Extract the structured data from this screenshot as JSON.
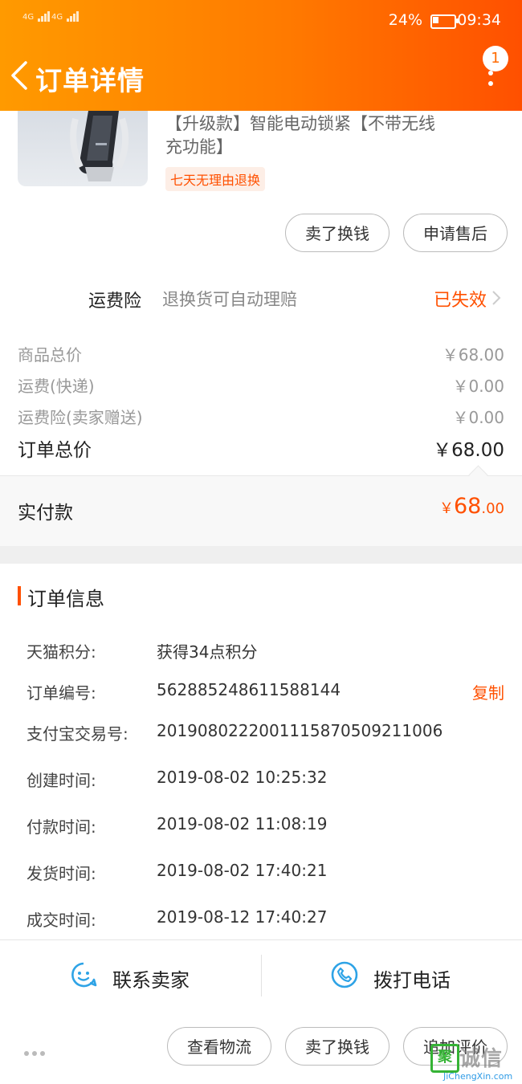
{
  "status_bar": {
    "signal_1": "4G",
    "signal_2": "4G",
    "battery_percent": "24%",
    "time": "09:34"
  },
  "header": {
    "title": "订单详情",
    "notification_count": "1"
  },
  "product": {
    "title": "【升级款】智能电动锁紧【不带无线充功能】",
    "return_tag": "七天无理由退换",
    "actions": [
      "卖了换钱",
      "申请售后"
    ]
  },
  "insurance": {
    "label": "运费险",
    "description": "退换货可自动理赔",
    "status": "已失效"
  },
  "prices": [
    {
      "label": "商品总价",
      "value": "￥68.00"
    },
    {
      "label": "运费(快递)",
      "value": "￥0.00"
    },
    {
      "label": "运费险(卖家赠送)",
      "value": "￥0.00"
    }
  ],
  "order_total": {
    "label": "订单总价",
    "value": "￥68.00"
  },
  "paid": {
    "label": "实付款",
    "currency": "￥",
    "main": "68",
    "decimal": ".00"
  },
  "order_info": {
    "title": "订单信息",
    "copy_label": "复制",
    "rows": [
      {
        "key": "天猫积分:",
        "value": "获得34点积分"
      },
      {
        "key": "订单编号:",
        "value": "562885248611588144"
      },
      {
        "key": "支付宝交易号:",
        "value": "2019080222001115870509211006"
      },
      {
        "key": "创建时间:",
        "value": "2019-08-02 10:25:32"
      },
      {
        "key": "付款时间:",
        "value": "2019-08-02 11:08:19"
      },
      {
        "key": "发货时间:",
        "value": "2019-08-02 17:40:21"
      },
      {
        "key": "成交时间:",
        "value": "2019-08-12 17:40:27"
      }
    ]
  },
  "contact": {
    "seller_label": "联系卖家",
    "phone_label": "拨打电话"
  },
  "bottom_bar": {
    "buttons": [
      "查看物流",
      "卖了换钱",
      "追加评价"
    ]
  },
  "watermark": {
    "logo_char": "聚",
    "text": "诚信",
    "url": "JiChengXin.com"
  },
  "colors": {
    "accent": "#ff5000",
    "header_start": "#ff9a00",
    "header_end": "#ff5000",
    "icon_blue": "#2ea3e6"
  },
  "icons": [
    "back-chevron-icon",
    "more-dots-icon",
    "chevron-right-icon",
    "chat-face-icon",
    "phone-icon",
    "more-dots-icon"
  ]
}
